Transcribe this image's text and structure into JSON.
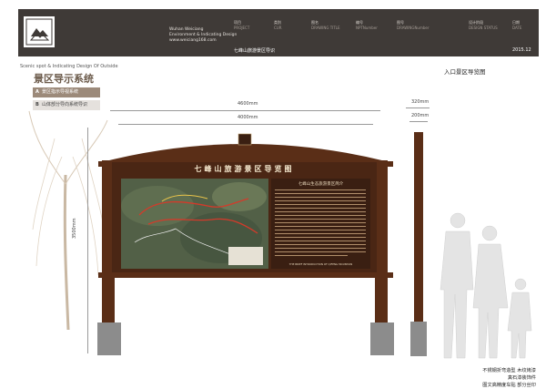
{
  "header": {
    "company_lines": [
      "Wuhan Weiciang",
      "Environment & Indicating Design",
      "www.weiciang168.com"
    ],
    "columns": [
      {
        "cn": "项目",
        "en": "PROJECT"
      },
      {
        "cn": "类别",
        "en": "CUR"
      },
      {
        "cn": "图名",
        "en": "DRAWING TITLE"
      },
      {
        "cn": "编号",
        "en": "NPTNumber"
      },
      {
        "cn": "图号",
        "en": "DRAWINGNumber"
      },
      {
        "cn": "设计阶段",
        "en": "DESIGN STATUS"
      },
      {
        "cn": "日期",
        "en": "DATE"
      }
    ],
    "project_title": "七峰山旅游景区导识",
    "date": "2015.12"
  },
  "subtitle_en": "Scenic spot & Indicating Design Of Outside",
  "subtitle_cn": "景区导示系统",
  "page_label": "入口景区导览图",
  "tabs": [
    {
      "letter": "A",
      "label": "景区指示导视系统"
    },
    {
      "letter": "B",
      "label": "山体部分导向系统导识"
    }
  ],
  "dimensions": {
    "overall_width": "4600mm",
    "inner_width": "4000mm",
    "height": "3500mm",
    "side_depth": "320mm",
    "side_post": "200mm"
  },
  "board": {
    "title": "七峰山旅游景区导览图",
    "intro_title": "七峰山生态旅游景区简介",
    "intro_footer": "THE BRIEF INTRODUCTION OF QIFENG MOUNTAIN"
  },
  "notes": [
    "不锈钢折弯造型 木纹烤漆",
    "真石漆装饰件",
    "图文高精度车贴 部分丝印"
  ],
  "colors": {
    "header": "#3f3a37",
    "wood": "#5a2e17",
    "tab_active": "#9c8a7a",
    "map_route": "#d43a2a"
  }
}
